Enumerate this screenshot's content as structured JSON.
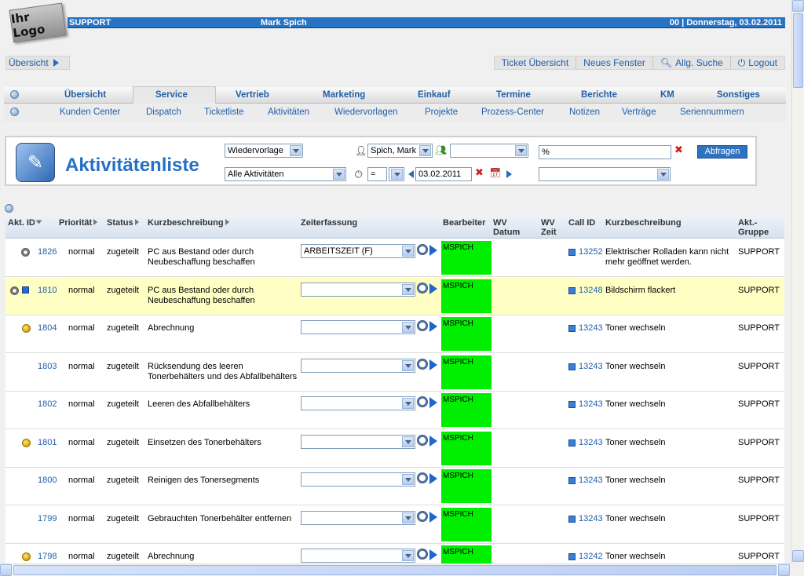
{
  "logo": "Ihr Logo",
  "topbar": {
    "left": "SUPPORT",
    "user": "Mark Spich",
    "right": "00 | Donnerstag, 03.02.2011"
  },
  "overview_link": "Übersicht",
  "toplinks": [
    "Ticket Übersicht",
    "Neues Fenster",
    "Allg. Suche",
    "Logout"
  ],
  "menu1": [
    "Übersicht",
    "Service",
    "Vertrieb",
    "Marketing",
    "Einkauf",
    "Termine",
    "Berichte",
    "KM",
    "Sonstiges"
  ],
  "menu1_active": "Service",
  "menu2": [
    "Kunden Center",
    "Dispatch",
    "Ticketliste",
    "Aktivitäten",
    "Wiedervorlagen",
    "Projekte",
    "Prozess-Center",
    "Notizen",
    "Verträge",
    "Seriennummern"
  ],
  "filter": {
    "title": "Aktivitätenliste",
    "wiedervorlage": "Wiedervorlage",
    "alle_aktivitaeten": "Alle Aktivitäten",
    "user": "Spich, Mark",
    "group": "",
    "operator": "=",
    "operator2": "",
    "date": "03.02.2011",
    "search_value": "%",
    "extra_select": "",
    "query_button": "Abfragen"
  },
  "table": {
    "headers": {
      "akt_id": "Akt. ID",
      "prioritaet": "Priorität",
      "status": "Status",
      "kurzbeschreibung": "Kurzbeschreibung",
      "zeiterfassung": "Zeiterfassung",
      "bearbeiter": "Bearbeiter",
      "wv_datum": "WV Datum",
      "wv_zeit": "WV Zeit",
      "call_id": "Call ID",
      "call_kurzbeschreibung": "Kurzbeschreibung",
      "akt_gruppe": "Akt.- Gruppe"
    },
    "rows": [
      {
        "id": "1826",
        "icon": "gear",
        "prio": "normal",
        "status": "zugeteilt",
        "desc": "PC aus Bestand oder durch Neubeschaffung beschaffen",
        "zeit": "ARBEITSZEIT (F)",
        "bearbeiter": "MSPICH",
        "call_id": "13252",
        "call_desc": "Elektrischer Rolladen kann nicht mehr geöffnet werden.",
        "gruppe": "SUPPORT"
      },
      {
        "id": "1810",
        "icon": "gear-note",
        "prio": "normal",
        "status": "zugeteilt",
        "desc": "PC aus Bestand oder durch Neubeschaffung beschaffen",
        "zeit": "",
        "bearbeiter": "MSPICH",
        "call_id": "13248",
        "call_desc": "Bildschirm flackert",
        "gruppe": "SUPPORT"
      },
      {
        "id": "1804",
        "icon": "coin",
        "prio": "normal",
        "status": "zugeteilt",
        "desc": "Abrechnung",
        "zeit": "",
        "bearbeiter": "MSPICH",
        "call_id": "13243",
        "call_desc": "Toner wechseln",
        "gruppe": "SUPPORT"
      },
      {
        "id": "1803",
        "icon": "",
        "prio": "normal",
        "status": "zugeteilt",
        "desc": "Rücksendung des leeren Tonerbehälters und des Abfallbehälters",
        "zeit": "",
        "bearbeiter": "MSPICH",
        "call_id": "13243",
        "call_desc": "Toner wechseln",
        "gruppe": "SUPPORT"
      },
      {
        "id": "1802",
        "icon": "",
        "prio": "normal",
        "status": "zugeteilt",
        "desc": "Leeren des Abfallbehälters",
        "zeit": "",
        "bearbeiter": "MSPICH",
        "call_id": "13243",
        "call_desc": "Toner wechseln",
        "gruppe": "SUPPORT"
      },
      {
        "id": "1801",
        "icon": "coin",
        "prio": "normal",
        "status": "zugeteilt",
        "desc": "Einsetzen des Tonerbehälters",
        "zeit": "",
        "bearbeiter": "MSPICH",
        "call_id": "13243",
        "call_desc": "Toner wechseln",
        "gruppe": "SUPPORT"
      },
      {
        "id": "1800",
        "icon": "",
        "prio": "normal",
        "status": "zugeteilt",
        "desc": "Reinigen des Tonersegments",
        "zeit": "",
        "bearbeiter": "MSPICH",
        "call_id": "13243",
        "call_desc": "Toner wechseln",
        "gruppe": "SUPPORT"
      },
      {
        "id": "1799",
        "icon": "",
        "prio": "normal",
        "status": "zugeteilt",
        "desc": "Gebrauchten Tonerbehälter entfernen",
        "zeit": "",
        "bearbeiter": "MSPICH",
        "call_id": "13243",
        "call_desc": "Toner wechseln",
        "gruppe": "SUPPORT"
      },
      {
        "id": "1798",
        "icon": "coin",
        "prio": "normal",
        "status": "zugeteilt",
        "desc": "Abrechnung",
        "zeit": "",
        "bearbeiter": "MSPICH",
        "call_id": "13242",
        "call_desc": "Toner wechseln",
        "gruppe": "SUPPORT"
      }
    ]
  },
  "colors": {
    "accent": "#2773c4",
    "highlight_row": "#ffffc4",
    "bearbeiter_bg": "#00ee00"
  }
}
